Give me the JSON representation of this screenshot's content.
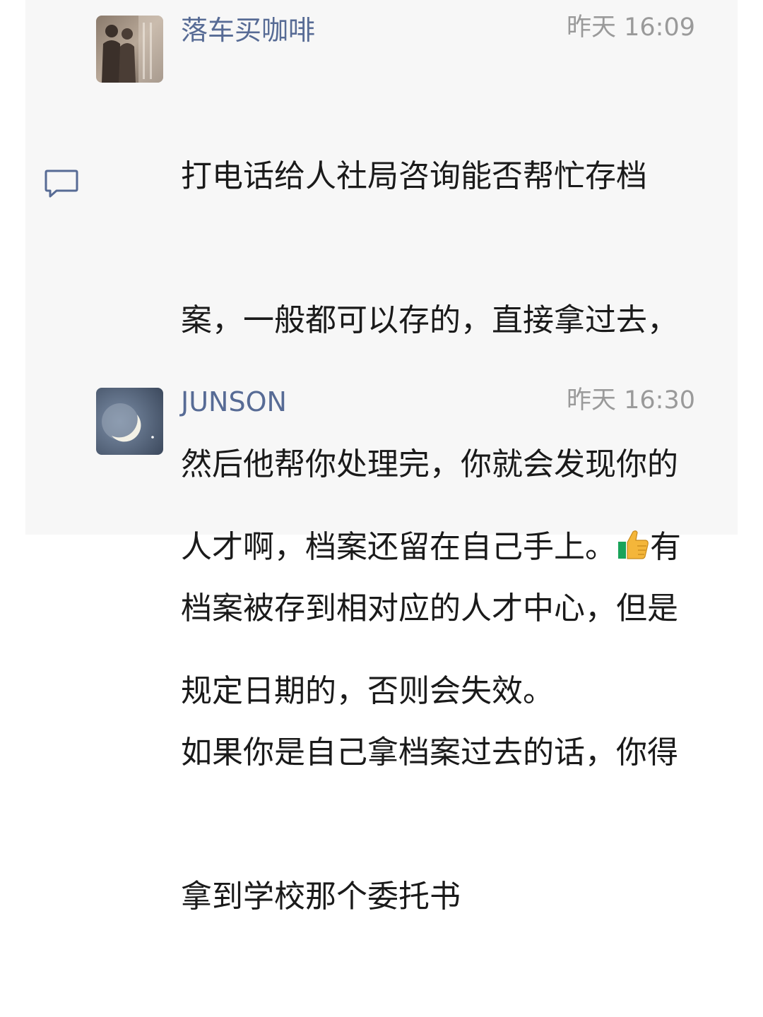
{
  "comments": [
    {
      "username": "落车买咖啡",
      "timestamp": "昨天 16:09",
      "lines": [
        "打电话给人社局咨询能否帮忙存档",
        "案，一般都可以存的，直接拿过去，",
        "然后他帮你处理完，你就会发现你的",
        "档案被存到相对应的人才中心，但是",
        "如果你是自己拿档案过去的话，你得",
        "拿到学校那个委托书"
      ]
    },
    {
      "username": "JUNSON",
      "timestamp": "昨天 16:30",
      "line1_before": "人才啊，档案还留在自己手上。",
      "line1_emoji": "thumbs-up-icon",
      "line1_after": "有",
      "line2": "规定日期的，否则会失效。"
    }
  ],
  "colors": {
    "username": "#576b95",
    "timestamp": "#9a9a9a",
    "panel_bg": "#f7f7f7",
    "text": "#1a1a1a"
  }
}
